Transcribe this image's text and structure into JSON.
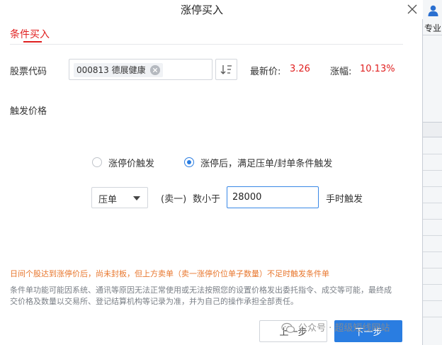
{
  "dialog": {
    "title": "涨停买入"
  },
  "tabs": [
    {
      "label": "条件买入",
      "active": true
    }
  ],
  "stock": {
    "label": "股票代码",
    "chip_text": "000813 德展健康",
    "latest_price_label": "最新价:",
    "latest_price": "3.26",
    "change_label": "涨幅:",
    "change_value": "10.13%"
  },
  "trigger": {
    "label": "触发价格",
    "options": [
      {
        "label": "涨停价触发",
        "selected": false
      },
      {
        "label": "涨停后，满足压单/封单条件触发",
        "selected": true
      }
    ],
    "condition": {
      "select_value": "压单",
      "prefix": "(卖一)",
      "compare": "数小于",
      "quantity": "28000",
      "suffix": "手时触发"
    }
  },
  "notices": {
    "warning": "日间个股达到涨停价后，尚未封板，但上方卖单（卖一涨停价位单子数量）不足时触发条件单",
    "disclaimer": "条件单功能可能因系统、通讯等原因无法正常使用或无法按照您的设置价格发出委托指令、成交等可能，最终成交价格及数量以交易所、登记结算机构等记录为准，并为自己的操作承担全部责任。"
  },
  "buttons": {
    "prev": "上一步",
    "next": "下一步"
  },
  "watermark": {
    "text": "公众号 · 超级短线网站"
  },
  "side_panel": {
    "user_label": "专业"
  },
  "colors": {
    "accent": "#2a7de1",
    "price_red": "#e02020",
    "warning_orange": "#e8772e"
  },
  "icons": {
    "close": "close-icon",
    "sort": "sort-icon",
    "chip_remove": "clear-icon",
    "dropdown": "chevron-down-icon",
    "user": "user-icon",
    "watermark": "wechat-icon"
  }
}
